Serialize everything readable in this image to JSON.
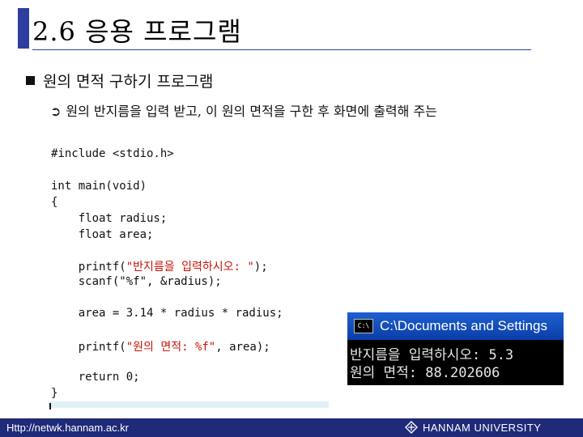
{
  "slide": {
    "title": "2.6 응용 프로그램",
    "bullet": "원의 면적 구하기 프로그램",
    "sub_bullet": "원의 반지름을 입력 받고, 이 원의 면적을 구한 후 화면에 출력해 주는"
  },
  "code": {
    "lines": [
      "#include <stdio.h>",
      "",
      "int main(void)",
      "{",
      "    float radius;",
      "    float area;",
      "",
      "    printf(\"반지름을 입력하시오: \");",
      "    scanf(\"%f\", &radius);",
      "",
      "    area = 3.14 * radius * radius;",
      "",
      "    printf(\"원의 면적: %f\", area);",
      "",
      "    return 0;",
      "}"
    ]
  },
  "console": {
    "window_title": "C:\\Documents and Settings",
    "icon_label": "C:\\",
    "output": [
      "반지름을 입력하시오: 5.3",
      "원의 면적: 88.202606"
    ]
  },
  "footer": {
    "url": "Http://netwk.hannam.ac.kr",
    "university": "HANNAM UNIVERSITY"
  },
  "colors": {
    "accent": "#2f3e9e",
    "footer_bg": "#1f2a78",
    "code_string_korean": "#c8140a",
    "console_title_bg": "#0a3ea8"
  }
}
